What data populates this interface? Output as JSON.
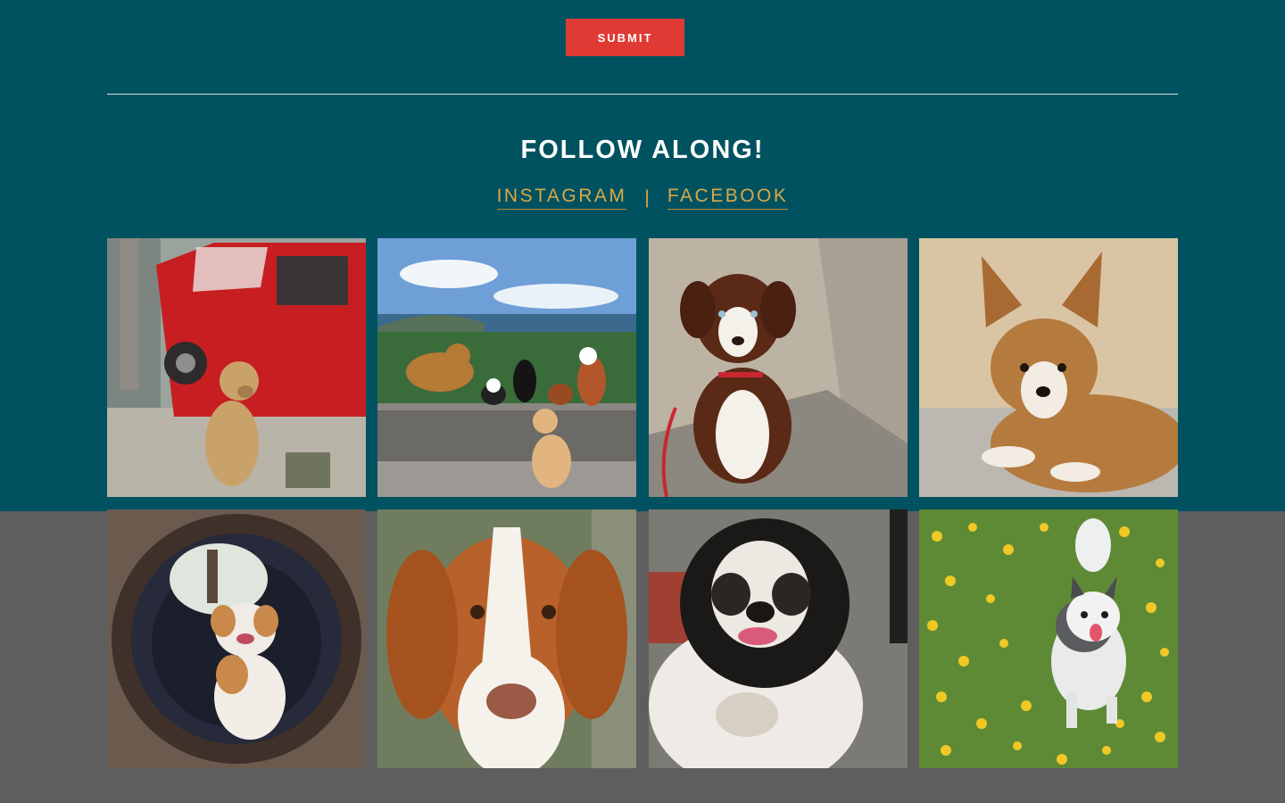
{
  "form": {
    "submit_label": "SUBMIT"
  },
  "follow": {
    "title": "FOLLOW ALONG!",
    "links": [
      {
        "label": "INSTAGRAM"
      },
      {
        "label": "FACEBOOK"
      }
    ],
    "separator": "|"
  },
  "gallery": {
    "photos": [
      {
        "subject": "tan dog sitting by red van"
      },
      {
        "subject": "group of dogs on stone wall with bay view"
      },
      {
        "subject": "brown and white puppy on sand"
      },
      {
        "subject": "fluffy corgi puppy lying down"
      },
      {
        "subject": "bulldog sitting in a tunnel"
      },
      {
        "subject": "brittany spaniel close-up"
      },
      {
        "subject": "shih tzu with tongue out"
      },
      {
        "subject": "husky-like dog running in yellow flowers"
      }
    ]
  },
  "colors": {
    "teal_band": "#005260",
    "gray_band": "#5e5e5e",
    "submit_button": "#e03a35",
    "link_gold": "#d9a84a"
  }
}
